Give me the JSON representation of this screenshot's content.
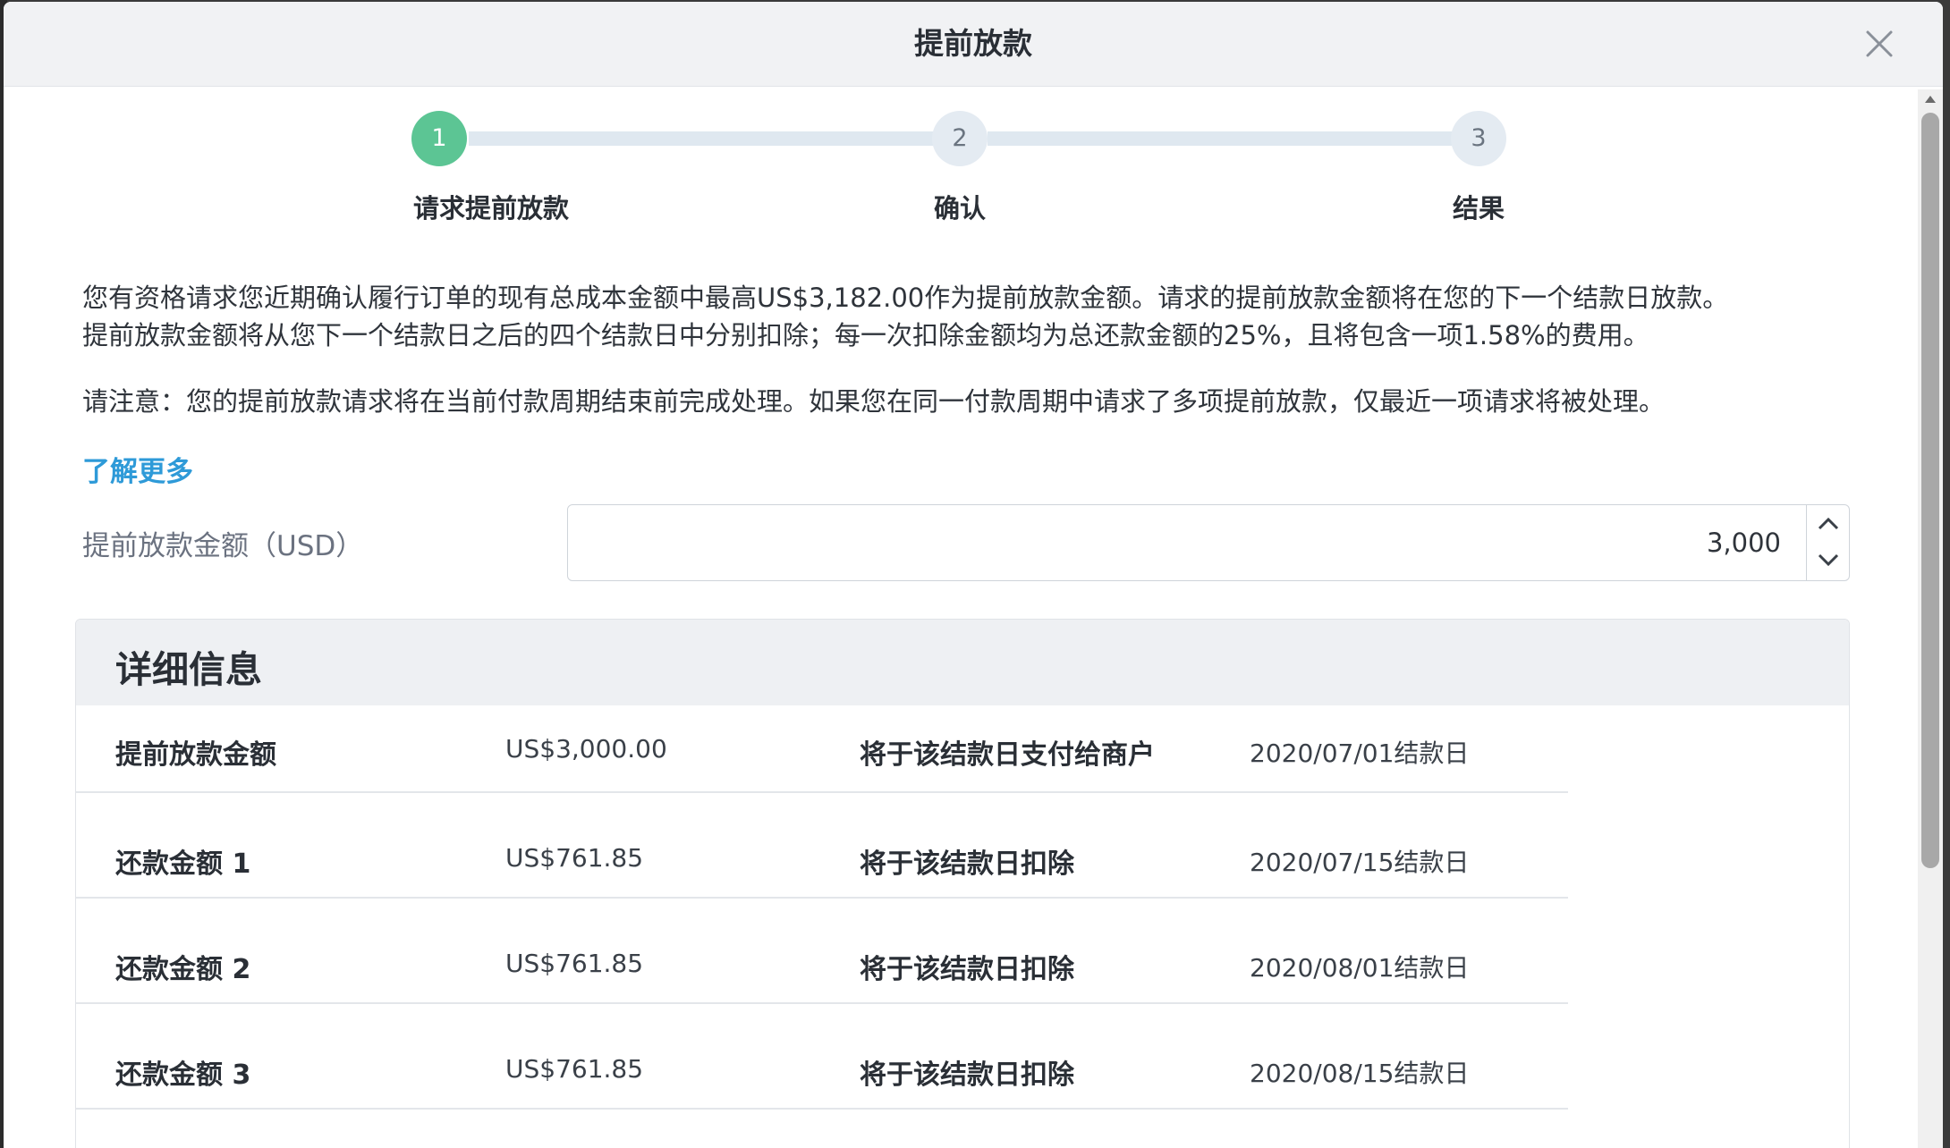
{
  "modal": {
    "title": "提前放款"
  },
  "stepper": {
    "steps": [
      {
        "number": "1",
        "label": "请求提前放款",
        "state": "active"
      },
      {
        "number": "2",
        "label": "确认",
        "state": "pending"
      },
      {
        "number": "3",
        "label": "结果",
        "state": "pending"
      }
    ]
  },
  "intro": {
    "line1": "您有资格请求您近期确认履行订单的现有总成本金额中最高US$3,182.00作为提前放款金额。请求的提前放款金额将在您的下一个结款日放款。",
    "line2": "提前放款金额将从您下一个结款日之后的四个结款日中分别扣除；每一次扣除金额均为总还款金额的25%，且将包含一项1.58%的费用。",
    "note": "请注意：您的提前放款请求将在当前付款周期结束前完成处理。如果您在同一付款周期中请求了多项提前放款，仅最近一项请求将被处理。",
    "learn_more": "了解更多"
  },
  "amount": {
    "label": "提前放款金额（USD）",
    "value": "3,000"
  },
  "details": {
    "title": "详细信息",
    "rows": [
      {
        "label": "提前放款金额",
        "value": "US$3,000.00",
        "label2": "将于该结款日支付给商户",
        "value2": "2020/07/01结款日"
      },
      {
        "label": "还款金额 1",
        "value": "US$761.85",
        "label2": "将于该结款日扣除",
        "value2": "2020/07/15结款日"
      },
      {
        "label": "还款金额 2",
        "value": "US$761.85",
        "label2": "将于该结款日扣除",
        "value2": "2020/08/01结款日"
      },
      {
        "label": "还款金额 3",
        "value": "US$761.85",
        "label2": "将于该结款日扣除",
        "value2": "2020/08/15结款日"
      }
    ]
  },
  "colors": {
    "accent_green": "#5cc594",
    "link_blue": "#2e9ad8",
    "header_bg": "#f1f2f4"
  }
}
